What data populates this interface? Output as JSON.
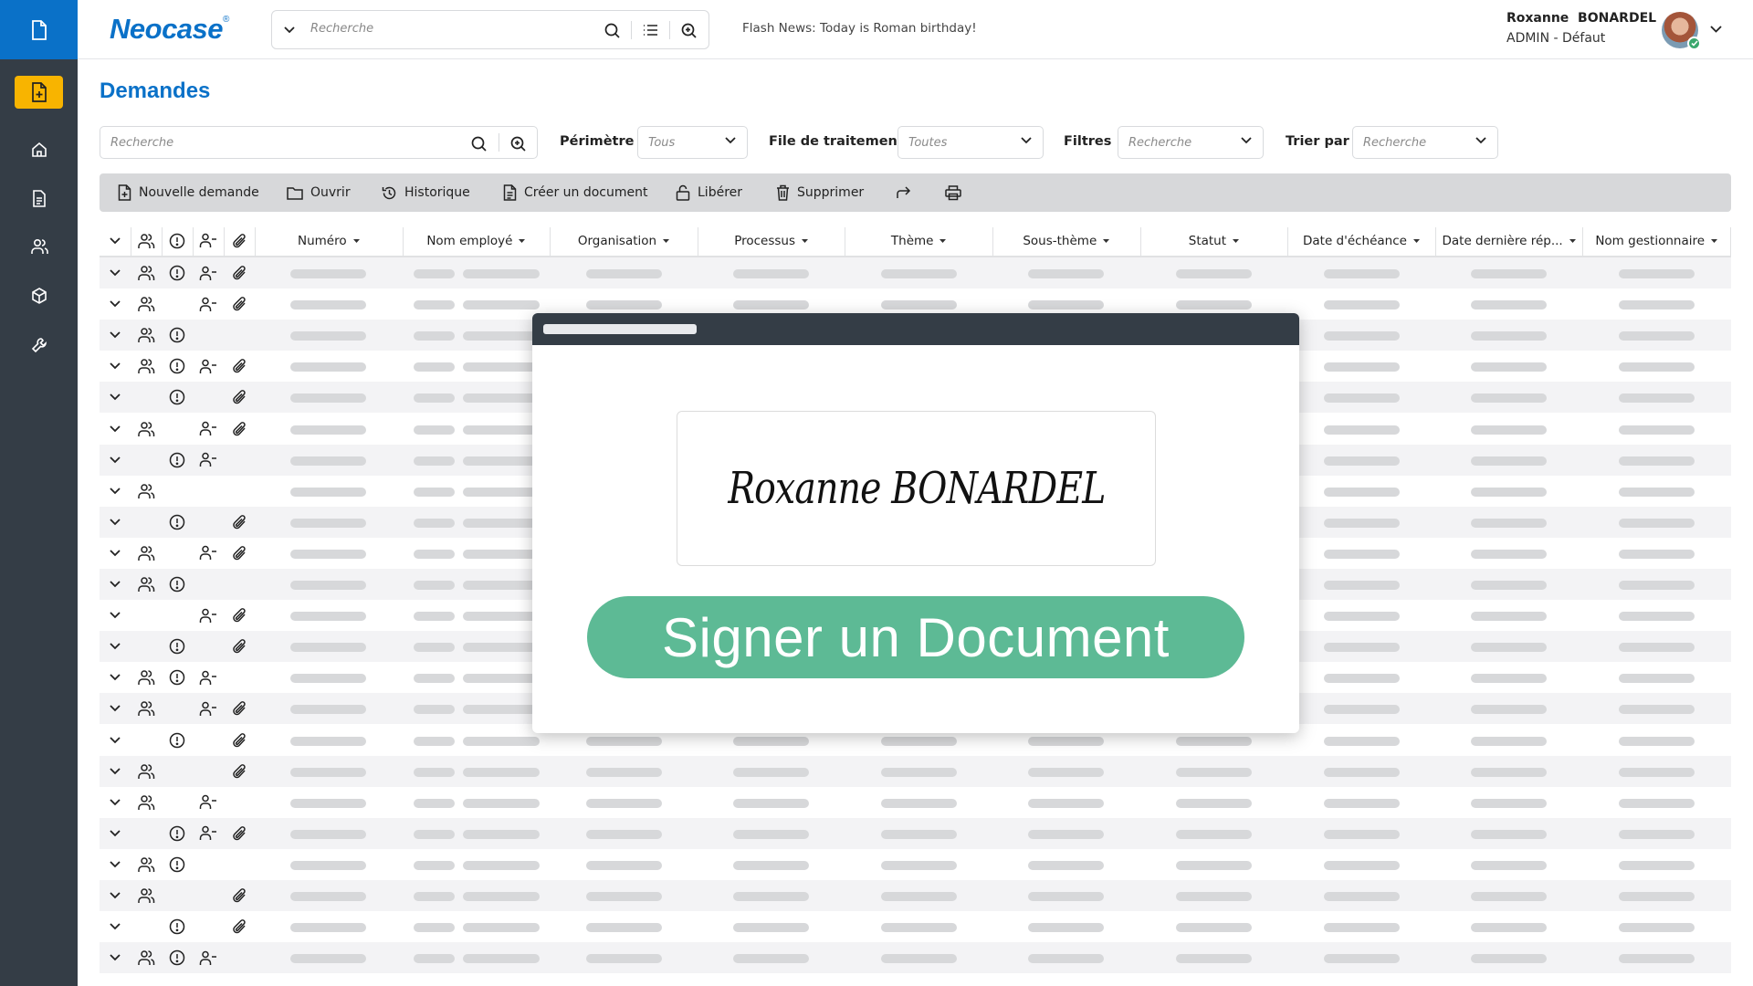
{
  "app": {
    "logo": "Neocase",
    "logo_mark": "®",
    "brand_color": "#0a71c8",
    "sidebar_color": "#343d46",
    "active_color": "#f8b400"
  },
  "sidebar": {
    "top_icon": "document-icon",
    "items": [
      {
        "name": "new-request",
        "icon": "file-plus-icon",
        "active": true
      },
      {
        "name": "home",
        "icon": "home-icon",
        "active": false
      },
      {
        "name": "documents",
        "icon": "file-text-icon",
        "active": false
      },
      {
        "name": "users",
        "icon": "users-icon",
        "active": false
      },
      {
        "name": "packages",
        "icon": "cube-icon",
        "active": false
      },
      {
        "name": "tools",
        "icon": "wrench-icon",
        "active": false
      }
    ]
  },
  "header": {
    "search_placeholder": "Recherche",
    "flash_news": "Flash News: Today is Roman birthday!",
    "user_name": "Roxanne  BONARDEL",
    "user_role": "ADMIN - Défaut",
    "user_status": "online"
  },
  "page": {
    "title": "Demandes",
    "search_placeholder": "Recherche",
    "filters": [
      {
        "label": "Périmètre",
        "value": "Tous"
      },
      {
        "label": "File de traitement",
        "value": "Toutes"
      },
      {
        "label": "Filtres",
        "value": "Recherche"
      },
      {
        "label": "Trier par",
        "value": "Recherche"
      }
    ]
  },
  "toolbar": {
    "buttons": [
      {
        "label": "Nouvelle demande",
        "icon": "file-plus-icon"
      },
      {
        "label": "Ouvrir",
        "icon": "folder-icon"
      },
      {
        "label": "Historique",
        "icon": "history-icon"
      },
      {
        "label": "Créer un document",
        "icon": "file-text-icon"
      },
      {
        "label": "Libérer",
        "icon": "unlock-icon"
      },
      {
        "label": "Supprimer",
        "icon": "trash-icon"
      },
      {
        "label": "",
        "icon": "forward-icon"
      },
      {
        "label": "",
        "icon": "print-icon"
      }
    ]
  },
  "table": {
    "icon_columns": [
      "expand",
      "group-icon",
      "alert-icon",
      "user-minus-icon",
      "paperclip-icon"
    ],
    "columns": [
      "Numéro",
      "Nom employé",
      "Organisation",
      "Processus",
      "Thème",
      "Sous-thème",
      "Statut",
      "Date d'échéance",
      "Date dernière rép...",
      "Nom gestionnaire"
    ],
    "rows": [
      {
        "group": true,
        "alert": true,
        "user": true,
        "attach": true
      },
      {
        "group": true,
        "alert": false,
        "user": true,
        "attach": true
      },
      {
        "group": true,
        "alert": true,
        "user": false,
        "attach": false
      },
      {
        "group": true,
        "alert": true,
        "user": true,
        "attach": true
      },
      {
        "group": false,
        "alert": true,
        "user": false,
        "attach": true
      },
      {
        "group": true,
        "alert": false,
        "user": true,
        "attach": true
      },
      {
        "group": false,
        "alert": true,
        "user": true,
        "attach": false
      },
      {
        "group": true,
        "alert": false,
        "user": false,
        "attach": false
      },
      {
        "group": false,
        "alert": true,
        "user": false,
        "attach": true
      },
      {
        "group": true,
        "alert": false,
        "user": true,
        "attach": true
      },
      {
        "group": true,
        "alert": true,
        "user": false,
        "attach": false
      },
      {
        "group": false,
        "alert": false,
        "user": true,
        "attach": true
      },
      {
        "group": false,
        "alert": true,
        "user": false,
        "attach": true
      },
      {
        "group": true,
        "alert": true,
        "user": true,
        "attach": false
      },
      {
        "group": true,
        "alert": false,
        "user": true,
        "attach": true
      },
      {
        "group": false,
        "alert": true,
        "user": false,
        "attach": true
      },
      {
        "group": true,
        "alert": false,
        "user": false,
        "attach": true
      },
      {
        "group": true,
        "alert": false,
        "user": true,
        "attach": false
      },
      {
        "group": false,
        "alert": true,
        "user": true,
        "attach": true
      },
      {
        "group": true,
        "alert": true,
        "user": false,
        "attach": false
      },
      {
        "group": true,
        "alert": false,
        "user": false,
        "attach": true
      },
      {
        "group": false,
        "alert": true,
        "user": false,
        "attach": true
      },
      {
        "group": true,
        "alert": true,
        "user": true,
        "attach": false
      }
    ]
  },
  "modal": {
    "signature": "Roxanne BONARDEL",
    "action_label": "Signer un Document",
    "action_color": "#5dba95"
  }
}
